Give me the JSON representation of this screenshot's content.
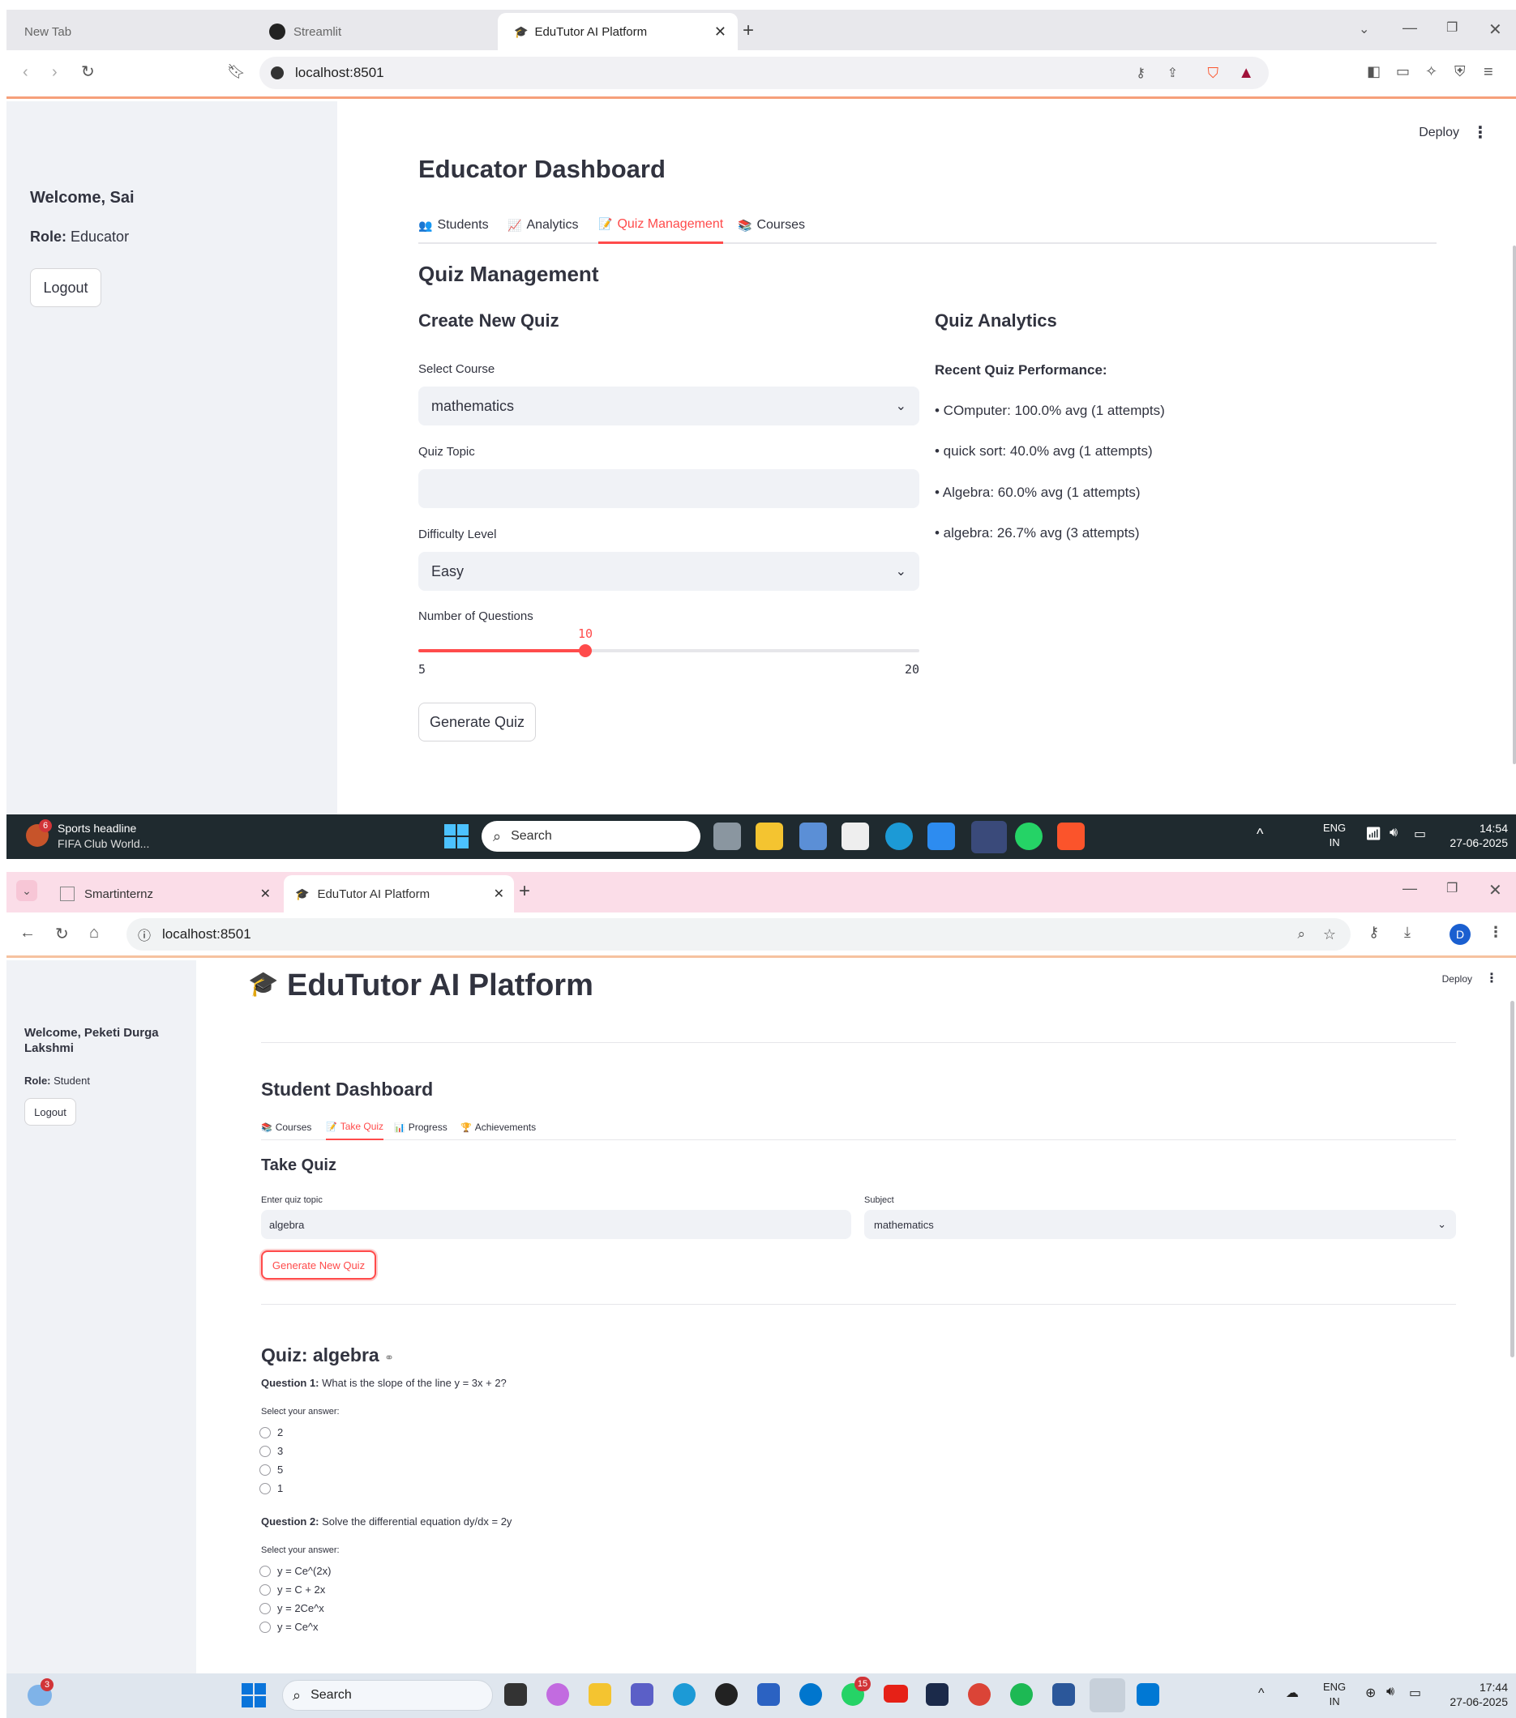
{
  "screen1": {
    "browser_tabs": [
      {
        "label": "New Tab"
      },
      {
        "label": "Streamlit"
      },
      {
        "label": "EduTutor AI Platform"
      }
    ],
    "url": "localhost:8501",
    "deploy_label": "Deploy",
    "sidebar": {
      "welcome": "Welcome, Sai",
      "role_label": "Role:",
      "role_value": "Educator",
      "logout": "Logout"
    },
    "title": "Educator Dashboard",
    "tabs": [
      {
        "icon": "👥",
        "label": "Students"
      },
      {
        "icon": "📈",
        "label": "Analytics"
      },
      {
        "icon": "📝",
        "label": "Quiz Management"
      },
      {
        "icon": "📚",
        "label": "Courses"
      }
    ],
    "section_title": "Quiz Management",
    "create_quiz": {
      "heading": "Create New Quiz",
      "course_label": "Select Course",
      "course_value": "mathematics",
      "topic_label": "Quiz Topic",
      "topic_value": "",
      "difficulty_label": "Difficulty Level",
      "difficulty_value": "Easy",
      "questions_label": "Number of Questions",
      "slider_value": "10",
      "slider_min": "5",
      "slider_max": "20",
      "slider_fraction": 0.3333,
      "generate_button": "Generate Quiz"
    },
    "analytics": {
      "heading": "Quiz Analytics",
      "subheading": "Recent Quiz Performance:",
      "items": [
        "• COmputer: 100.0% avg (1 attempts)",
        "• quick sort: 40.0% avg (1 attempts)",
        "• Algebra: 60.0% avg (1 attempts)",
        "• algebra: 26.7% avg (3 attempts)"
      ]
    },
    "taskbar": {
      "news_badge": "6",
      "news_line1": "Sports headline",
      "news_line2": "FIFA Club World...",
      "search": "Search",
      "lang1": "ENG",
      "lang2": "IN",
      "time": "14:54",
      "date": "27-06-2025"
    }
  },
  "screen2": {
    "browser_tabs": [
      {
        "label": "Smartinternz"
      },
      {
        "label": "EduTutor AI Platform"
      }
    ],
    "url": "localhost:8501",
    "profile_initial": "D",
    "deploy_label": "Deploy",
    "app_title": "EduTutor AI Platform",
    "sidebar": {
      "welcome": "Welcome, Peketi Durga Lakshmi",
      "role_label": "Role:",
      "role_value": "Student",
      "logout": "Logout"
    },
    "dashboard_title": "Student Dashboard",
    "tabs": [
      {
        "icon": "📚",
        "label": "Courses"
      },
      {
        "icon": "📝",
        "label": "Take Quiz"
      },
      {
        "icon": "📊",
        "label": "Progress"
      },
      {
        "icon": "🏆",
        "label": "Achievements"
      }
    ],
    "take_quiz": {
      "heading": "Take Quiz",
      "topic_label": "Enter quiz topic",
      "topic_value": "algebra",
      "subject_label": "Subject",
      "subject_value": "mathematics",
      "generate_button": "Generate New Quiz"
    },
    "quiz": {
      "title": "Quiz: algebra",
      "questions": [
        {
          "label": "Question 1:",
          "text": "What is the slope of the line y = 3x + 2?",
          "prompt": "Select your answer:",
          "options": [
            "2",
            "3",
            "5",
            "1"
          ]
        },
        {
          "label": "Question 2:",
          "text": "Solve the differential equation dy/dx = 2y",
          "prompt": "Select your answer:",
          "options": [
            "y = Ce^(2x)",
            "y = C + 2x",
            "y = 2Ce^x",
            "y = Ce^x"
          ]
        }
      ]
    },
    "taskbar": {
      "weather_badge": "3",
      "search": "Search",
      "whatsapp_badge": "15",
      "lang1": "ENG",
      "lang2": "IN",
      "time": "17:44",
      "date": "27-06-2025"
    }
  }
}
